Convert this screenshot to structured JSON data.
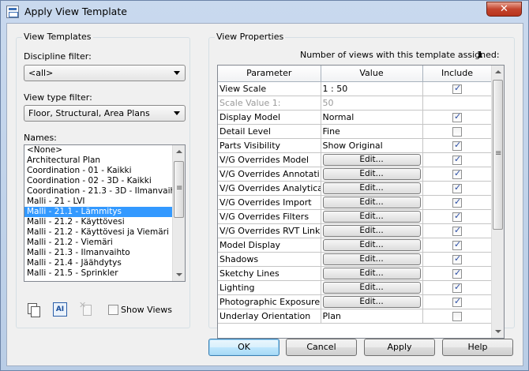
{
  "window": {
    "title": "Apply View Template",
    "close_glyph": "✕"
  },
  "left_panel": {
    "group_label": "View Templates",
    "discipline_filter": {
      "label": "Discipline filter:",
      "value": "<all>"
    },
    "view_type_filter": {
      "label": "View type filter:",
      "value": "Floor, Structural, Area Plans"
    },
    "names": {
      "label": "Names:",
      "items": [
        "<None>",
        "Architectural Plan",
        "Coordination - 01 - Kaikki",
        "Coordination - 02 - 3D - Kaikki",
        "Coordination - 21.3 - 3D - Ilmanvaihto",
        "Malli - 21 - LVI",
        "Malli - 21.1 - Lämmitys",
        "Malli - 21.2 - Käyttövesi",
        "Malli - 21.2 - Käyttövesi ja Viemäri",
        "Malli - 21.2 - Viemäri",
        "Malli - 21.3 - Ilmanvaihto",
        "Malli - 21.4 - Jäähdytys",
        "Malli - 21.5 - Sprinkler"
      ],
      "selected_index": 6
    },
    "toolbar": {
      "rename_icon_text": "AI"
    },
    "show_views_label": "Show Views"
  },
  "right_panel": {
    "group_label": "View Properties",
    "count_label": "Number of views with this template assigned:",
    "count_value": "1",
    "columns": [
      "Parameter",
      "Value",
      "Include"
    ],
    "rows": [
      {
        "param": "View Scale",
        "value": "1 : 50",
        "type": "text",
        "include": true,
        "disabled": false
      },
      {
        "param": "Scale Value    1:",
        "value": "50",
        "type": "text",
        "include": null,
        "disabled": true
      },
      {
        "param": "Display Model",
        "value": "Normal",
        "type": "text",
        "include": true,
        "disabled": false
      },
      {
        "param": "Detail Level",
        "value": "Fine",
        "type": "text",
        "include": false,
        "disabled": false
      },
      {
        "param": "Parts Visibility",
        "value": "Show Original",
        "type": "text",
        "include": true,
        "disabled": false
      },
      {
        "param": "V/G Overrides Model",
        "value": "Edit...",
        "type": "button",
        "include": true,
        "disabled": false
      },
      {
        "param": "V/G Overrides Annotati",
        "value": "Edit...",
        "type": "button",
        "include": true,
        "disabled": false
      },
      {
        "param": "V/G Overrides Analytica",
        "value": "Edit...",
        "type": "button",
        "include": true,
        "disabled": false
      },
      {
        "param": "V/G Overrides Import",
        "value": "Edit...",
        "type": "button",
        "include": true,
        "disabled": false
      },
      {
        "param": "V/G Overrides Filters",
        "value": "Edit...",
        "type": "button",
        "include": true,
        "disabled": false
      },
      {
        "param": "V/G Overrides RVT Links",
        "value": "Edit...",
        "type": "button",
        "include": true,
        "disabled": false
      },
      {
        "param": "Model Display",
        "value": "Edit...",
        "type": "button",
        "include": true,
        "disabled": false
      },
      {
        "param": "Shadows",
        "value": "Edit...",
        "type": "button",
        "include": true,
        "disabled": false
      },
      {
        "param": "Sketchy Lines",
        "value": "Edit...",
        "type": "button",
        "include": true,
        "disabled": false
      },
      {
        "param": "Lighting",
        "value": "Edit...",
        "type": "button",
        "include": true,
        "disabled": false
      },
      {
        "param": "Photographic Exposure",
        "value": "Edit...",
        "type": "button",
        "include": true,
        "disabled": false
      },
      {
        "param": "Underlay Orientation",
        "value": "Plan",
        "type": "text",
        "include": false,
        "disabled": false
      }
    ]
  },
  "buttons": {
    "ok": "OK",
    "cancel": "Cancel",
    "apply": "Apply",
    "help": "Help"
  }
}
